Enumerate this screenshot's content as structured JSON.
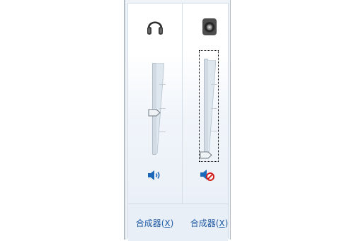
{
  "channels": [
    {
      "device_icon": "headphones-icon",
      "volume_fraction": 0.45,
      "muted": false,
      "mute_icon": "speaker-volume-icon",
      "link": {
        "label": "合成器(",
        "accel": "X",
        "close": ")"
      }
    },
    {
      "device_icon": "speaker-device-icon",
      "volume_fraction": 0.0,
      "muted": true,
      "mute_icon": "speaker-muted-icon",
      "link": {
        "label": "合成器(",
        "accel": "X",
        "close": ")"
      }
    }
  ],
  "colors": {
    "link": "#1f5aa6",
    "icon_blue": "#1b68b8",
    "mute_red": "#d22020"
  }
}
